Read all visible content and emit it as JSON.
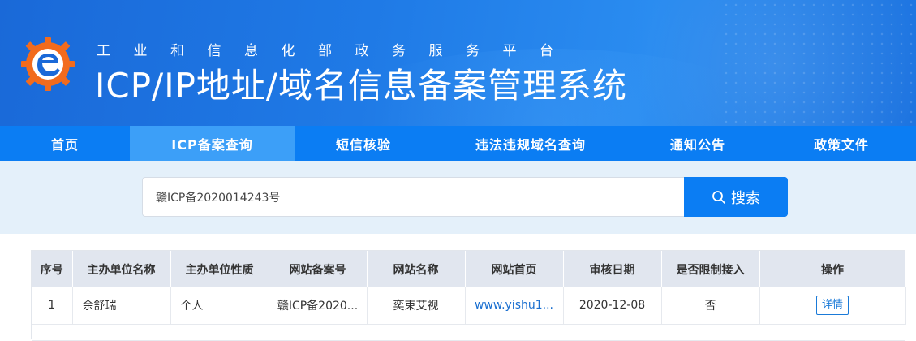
{
  "header": {
    "subtitle": "工业和信息化部政务服务平台",
    "title": "ICP/IP地址/域名信息备案管理系统",
    "logo_icon": "ministry-logo-icon"
  },
  "nav": {
    "items": [
      {
        "label": "首页"
      },
      {
        "label": "ICP备案查询",
        "active": true
      },
      {
        "label": "短信核验"
      },
      {
        "label": "违法违规域名查询"
      },
      {
        "label": "通知公告"
      },
      {
        "label": "政策文件"
      }
    ]
  },
  "search": {
    "value": "赣ICP备2020014243号",
    "button_label": "搜索",
    "icon": "search-icon"
  },
  "table": {
    "headers": [
      "序号",
      "主办单位名称",
      "主办单位性质",
      "网站备案号",
      "网站名称",
      "网站首页",
      "审核日期",
      "是否限制接入",
      "操作"
    ],
    "rows": [
      {
        "index": "1",
        "org_name": "余舒瑞",
        "org_type": "个人",
        "icp_no": "赣ICP备2020...",
        "site_name": "奕束艾视",
        "site_home": "www.yishu1...",
        "audit_date": "2020-12-08",
        "restricted": "否",
        "action": "详情"
      }
    ]
  },
  "colors": {
    "nav_bg": "#0b7df3",
    "nav_active": "#3c9ff8",
    "search_band": "#e4f0fa",
    "link": "#1a6fd0"
  }
}
